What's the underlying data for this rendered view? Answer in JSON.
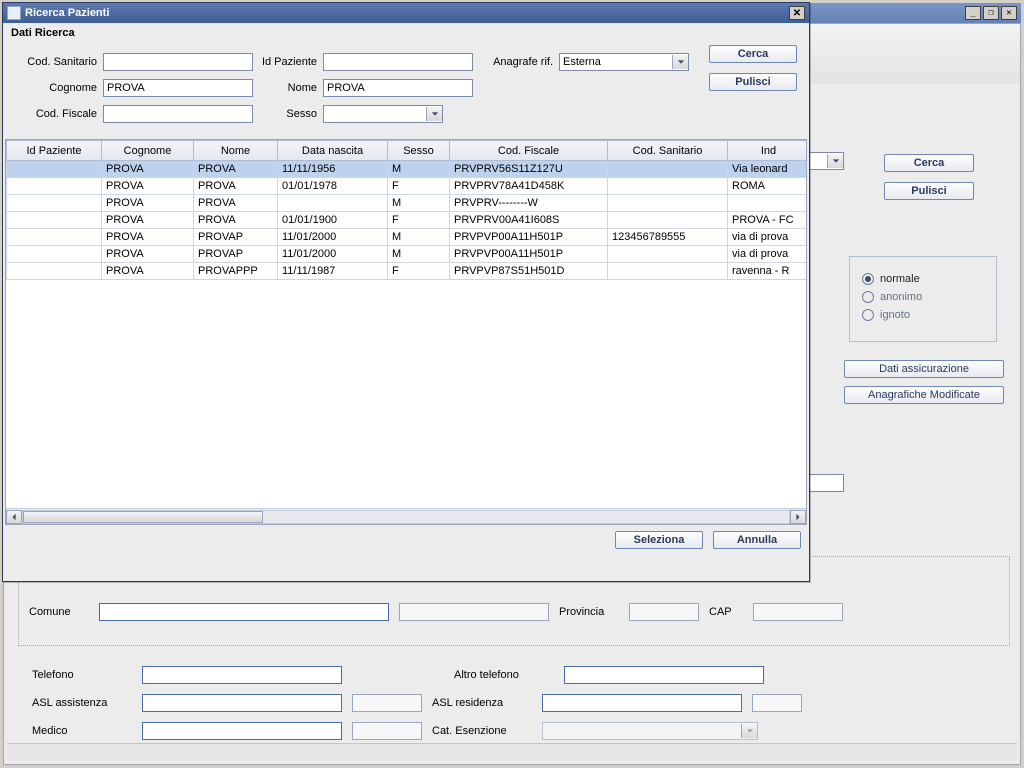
{
  "outer": {
    "min_icon": "_",
    "restore_icon": "❐",
    "close_icon": "✕"
  },
  "right": {
    "cerca": "Cerca",
    "pulisci": "Pulisci",
    "radio": {
      "normale": "normale",
      "anonimo": "anonimo",
      "ignoto": "ignoto",
      "selected": "normale"
    },
    "dati_assicurazione": "Dati assicurazione",
    "anagrafiche": "Anagrafiche Modificate"
  },
  "dialog": {
    "title": "Ricerca Pazienti",
    "group": "Dati Ricerca",
    "labels": {
      "cod_sanitario": "Cod. Sanitario",
      "id_paziente": "Id Paziente",
      "anagrafe_rif": "Anagrafe rif.",
      "cognome": "Cognome",
      "nome": "Nome",
      "cod_fiscale": "Cod. Fiscale",
      "sesso": "Sesso"
    },
    "values": {
      "cod_sanitario": "",
      "id_paziente": "",
      "anagrafe_rif": "Esterna",
      "cognome": "PROVA",
      "nome": "PROVA",
      "cod_fiscale": "",
      "sesso": ""
    },
    "buttons": {
      "cerca": "Cerca",
      "pulisci": "Pulisci",
      "seleziona": "Seleziona",
      "annulla": "Annulla"
    }
  },
  "table": {
    "cols": [
      "Id Paziente",
      "Cognome",
      "Nome",
      "Data nascita",
      "Sesso",
      "Cod. Fiscale",
      "Cod. Sanitario",
      "Ind"
    ],
    "rows": [
      {
        "id": "",
        "cognome": "PROVA",
        "nome": "PROVA",
        "data": "11/11/1956",
        "sesso": "M",
        "cf": "PRVPRV56S11Z127U",
        "san": "",
        "ind": "Via leonard",
        "sel": true
      },
      {
        "id": "",
        "cognome": "PROVA",
        "nome": "PROVA",
        "data": "01/01/1978",
        "sesso": "F",
        "cf": "PRVPRV78A41D458K",
        "san": "",
        "ind": "ROMA"
      },
      {
        "id": "",
        "cognome": "PROVA",
        "nome": "PROVA",
        "data": "",
        "sesso": "M",
        "cf": "PRVPRV--------W",
        "san": "",
        "ind": ""
      },
      {
        "id": "",
        "cognome": "PROVA",
        "nome": "PROVA",
        "data": "01/01/1900",
        "sesso": "F",
        "cf": "PRVPRV00A41I608S",
        "san": "",
        "ind": "PROVA - FC"
      },
      {
        "id": "",
        "cognome": "PROVA",
        "nome": "PROVAP",
        "data": "11/01/2000",
        "sesso": "M",
        "cf": "PRVPVP00A11H501P",
        "san": "123456789555",
        "ind": "via di prova"
      },
      {
        "id": "",
        "cognome": "PROVA",
        "nome": "PROVAP",
        "data": "11/01/2000",
        "sesso": "M",
        "cf": "PRVPVP00A11H501P",
        "san": "",
        "ind": "via di prova"
      },
      {
        "id": "",
        "cognome": "PROVA",
        "nome": "PROVAPPP",
        "data": "11/11/1987",
        "sesso": "F",
        "cf": "PRVPVP87S51H501D",
        "san": "",
        "ind": "ravenna - R"
      }
    ]
  },
  "lower": {
    "comune": "Comune",
    "provincia": "Provincia",
    "cap": "CAP",
    "telefono": "Telefono",
    "altro_telefono": "Altro telefono",
    "asl_assistenza": "ASL assistenza",
    "asl_residenza": "ASL residenza",
    "medico": "Medico",
    "cat_esenzione": "Cat. Esenzione"
  }
}
